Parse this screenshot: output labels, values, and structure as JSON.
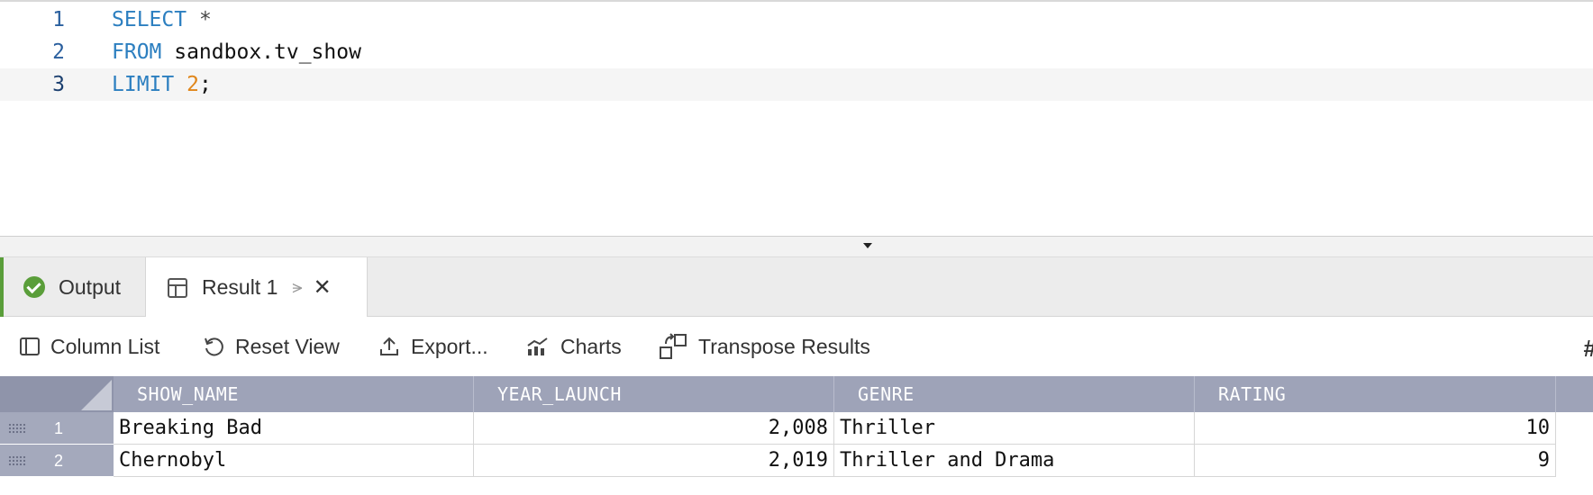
{
  "editor": {
    "lines": [
      {
        "number": "1",
        "tokens": {
          "kw1": "SELECT",
          "rest": " *"
        }
      },
      {
        "number": "2",
        "tokens": {
          "kw1": "FROM",
          "ident": " sandbox.tv_show"
        }
      },
      {
        "number": "3",
        "tokens": {
          "kw1": "LIMIT",
          "num": "2",
          "punct": ";"
        }
      }
    ]
  },
  "tabs": {
    "output_label": "Output",
    "result_label": "Result 1"
  },
  "toolbar": {
    "column_list": "Column List",
    "reset_view": "Reset View",
    "export": "Export...",
    "charts": "Charts",
    "transpose": "Transpose Results"
  },
  "grid": {
    "columns": [
      "SHOW_NAME",
      "YEAR_LAUNCH",
      "GENRE",
      "RATING"
    ],
    "rows": [
      {
        "index": "1",
        "show_name": "Breaking Bad",
        "year_launch": "2,008",
        "genre": "Thriller",
        "rating": "10"
      },
      {
        "index": "2",
        "show_name": "Chernobyl",
        "year_launch": "2,019",
        "genre": "Thriller and Drama",
        "rating": "9"
      }
    ]
  },
  "colors": {
    "keyword": "#2c7fc0",
    "number": "#e0861a",
    "success": "#5a9e3a",
    "grid_header": "#9ea3b8"
  },
  "icons": [
    "check-circle-icon",
    "table-icon",
    "pin-icon",
    "close-icon",
    "column-list-icon",
    "reset-view-icon",
    "export-icon",
    "charts-icon",
    "transpose-icon",
    "grid-icon",
    "row-grip-icon",
    "splitter-arrow-icon"
  ]
}
